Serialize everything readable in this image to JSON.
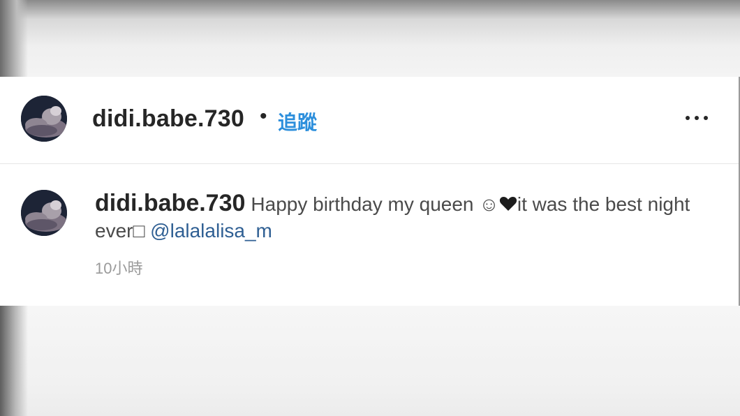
{
  "post": {
    "username": "didi.babe.730",
    "separator": "•",
    "follow_label": "追蹤"
  },
  "comment": {
    "username": "didi.babe.730",
    "text": "Happy birthday my queen ☺",
    "text_after_heart": "it was the best night ever",
    "unknown_glyph": "□",
    "mention": "@lalalalisa_m",
    "time": "10小時"
  },
  "icons": {
    "more": "more-options-icon",
    "heart": "black-heart-icon"
  },
  "colors": {
    "follow": "#2d8fdc",
    "mention": "#2f5f93",
    "time": "#9a9a9a"
  }
}
